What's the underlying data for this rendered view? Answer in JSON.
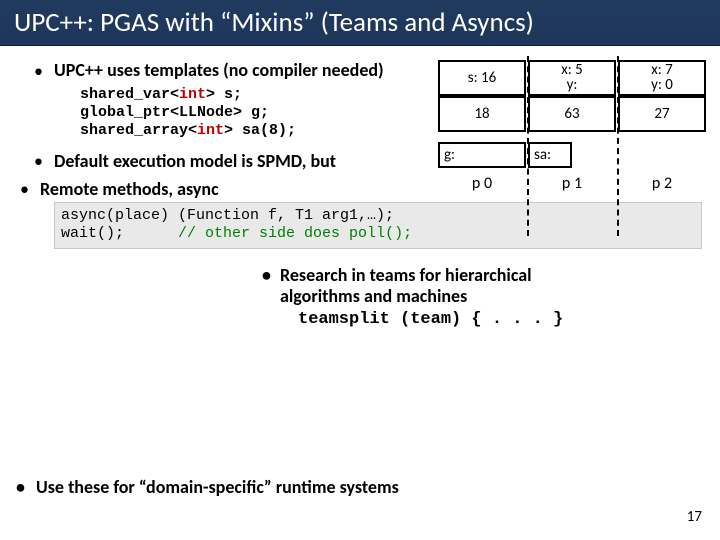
{
  "title": "UPC++: PGAS with “Mixins” (Teams and Asyncs)",
  "bullets": {
    "templates": "UPC++ uses templates (no compiler needed)",
    "spmd": "Default execution model is SPMD, but",
    "remote": "Remote methods, async",
    "research_l1": "Research in teams for hierarchical",
    "research_l2": "algorithms and machines",
    "domain": "Use these for “domain-specific” runtime systems"
  },
  "code": {
    "decl1a": "shared_var<",
    "decl1b": "int",
    "decl1c": "> s;",
    "decl2": "global_ptr<LLNode> g;",
    "decl3a": "shared_array<",
    "decl3b": "int",
    "decl3c": "> sa(8);",
    "async1": "async(place) (Function f, T1 arg1,…);",
    "async2a": "wait();      ",
    "async2b": "// other side does poll();",
    "teamsplit": "teamsplit (team) { . . . }"
  },
  "diagram": {
    "p0": {
      "top": "s: 16",
      "mid": "18",
      "g": "g:",
      "label": "p 0"
    },
    "p1": {
      "top1": "x: 5",
      "top2": "y:",
      "mid": "63",
      "g": "sa:",
      "label": "p 1"
    },
    "p2": {
      "top1": "x: 7",
      "top2": "y: 0",
      "mid": "27",
      "label": "p 2"
    }
  },
  "pagenum": "17"
}
